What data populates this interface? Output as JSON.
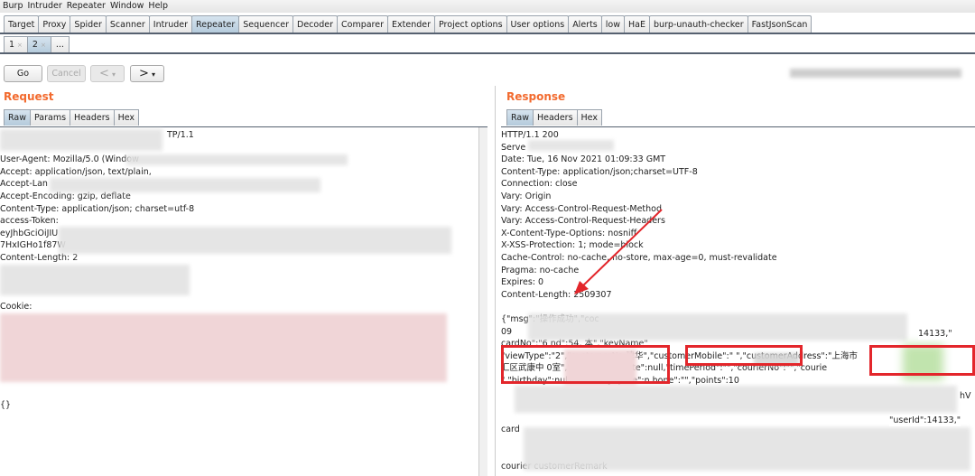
{
  "menu": [
    "Burp",
    "Intruder",
    "Repeater",
    "Window",
    "Help"
  ],
  "tabs": [
    "Target",
    "Proxy",
    "Spider",
    "Scanner",
    "Intruder",
    "Repeater",
    "Sequencer",
    "Decoder",
    "Comparer",
    "Extender",
    "Project options",
    "User options",
    "Alerts",
    "low",
    "HaE",
    "burp-unauth-checker",
    "FastJsonScan"
  ],
  "active_tab": "Repeater",
  "subtabs": [
    {
      "label": "1",
      "close": "×"
    },
    {
      "label": "2",
      "close": "×"
    },
    {
      "label": "..."
    }
  ],
  "toolbar": {
    "go": "Go",
    "cancel": "Cancel",
    "back": "<",
    "forward": ">",
    "dropdown": "▾"
  },
  "request": {
    "title": "Request",
    "tabs": [
      "Raw",
      "Params",
      "Headers",
      "Hex"
    ],
    "lines": [
      "TP/1.1",
      "",
      "User-Agent: Mozilla/5.0 (Window",
      "Accept: application/json, text/plain,",
      "Accept-Lan",
      "Accept-Encoding: gzip, deflate",
      "Content-Type: application/json; charset=utf-8",
      "access-Token:",
      "eyJhbGciOiJIU",
      "7HxIGHo1f87W",
      "Content-Length: 2",
      "",
      "",
      "",
      "Cookie:",
      "",
      "",
      "",
      "",
      "",
      "",
      "",
      "{}"
    ]
  },
  "response": {
    "title": "Response",
    "tabs": [
      "Raw",
      "Headers",
      "Hex"
    ],
    "lines": [
      "HTTP/1.1 200",
      "Serve",
      "Date: Tue, 16 Nov 2021 01:09:33 GMT",
      "Content-Type: application/json;charset=UTF-8",
      "Connection: close",
      "Vary: Origin",
      "Vary: Access-Control-Request-Method",
      "Vary: Access-Control-Request-Headers",
      "X-Content-Type-Options: nosniff",
      "X-XSS-Protection: 1; mode=block",
      "Cache-Control: no-cache, no-store, max-age=0, must-revalidate",
      "Pragma: no-cache",
      "Expires: 0",
      "Content-Length: 2509307",
      "",
      "{\"msg\":\"操作成功\",\"coc",
      "09",
      "cardNo\":\"6        nd\":54,                                  本\",\"keyName\"",
      "        \"viewType\":\"2\",\"customerNa      建华\",\"customerMobile\":\"          \",\"customerAddress\":\"上海市",
      "汇区武康中                   0室\",\"distributionDate\":null,\"timePeriod\":\"\",\"courierNo\":\"\",\"courie",
      "                                 \",\"birthday\":null,\"birthdaySpare\":n          hone\":\"\",\"points\":10",
      "",
      "",
      "",
      "card",
      "",
      "",
      "courier            customerRemark"
    ],
    "right_snippets": [
      "14133,\"",
      "\"userId\":14133,\"",
      "hV"
    ]
  },
  "colors": {
    "accent": "#f26a2e",
    "highlight": "#e3262b",
    "active_tab": "#b4cadb"
  }
}
